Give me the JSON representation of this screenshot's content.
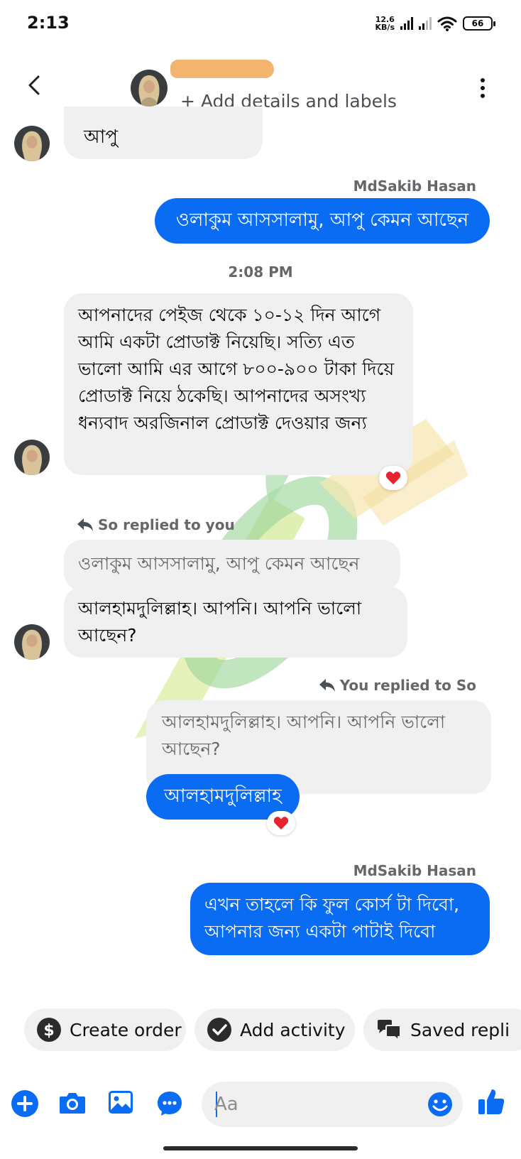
{
  "status_bar": {
    "time": "2:13",
    "net_speed_value": "12.6",
    "net_speed_unit": "KB/s",
    "battery": "66"
  },
  "header": {
    "add_details": "+ Add details and labels"
  },
  "messages": {
    "m1_text": "আপু",
    "m2_sender": "MdSakib Hasan",
    "m2_text": "ওলাকুম আসসালামু, আপু কেমন আছেন",
    "time_divider": "2:08 PM",
    "m3_text": "আপনাদের পেইজ থেকে ১০-১২ দিন আগে আমি একটা প্রোডাক্ট নিয়েছি। সত্যি এত ভালো আমি এর আগে ৮০০-৯০০ টাকা দিয়ে প্রোডাক্ট নিয়ে ঠকেছি। আপনাদের অসংখ্য ধন্যবাদ অরজিনাল প্রোডাক্ট দেওয়ার জন্য",
    "m3_reaction": "heart",
    "reply1_label": "So replied to you",
    "reply1_quote": "ওলাকুম আসসালামু, আপু কেমন আছেন",
    "m4_text": "আলহামদুলিল্লাহ। আপনি। আপনি ভালো আছেন?",
    "reply2_label": "You replied to So",
    "reply2_quote": "আলহামদুলিল্লাহ। আপনি। আপনি ভালো আছেন?",
    "m5_text": "আলহামদুলিল্লাহ",
    "m5_reaction": "heart",
    "m6_sender": "MdSakib Hasan",
    "m6_text": "এখন তাহলে কি ফুল কোর্স টা দিবো, আপনার জন্য একটা পাটাই দিবো"
  },
  "actions": {
    "create_order": "Create order",
    "add_activity": "Add activity",
    "saved_replies": "Saved repli"
  },
  "composer": {
    "placeholder": "Aa"
  },
  "colors": {
    "outgoing_bubble": "#0a6cf2",
    "incoming_bubble": "#f0f0f0",
    "accent": "#0a6cf2",
    "redaction": "#f2b46f",
    "reaction_heart": "#e8232d"
  }
}
